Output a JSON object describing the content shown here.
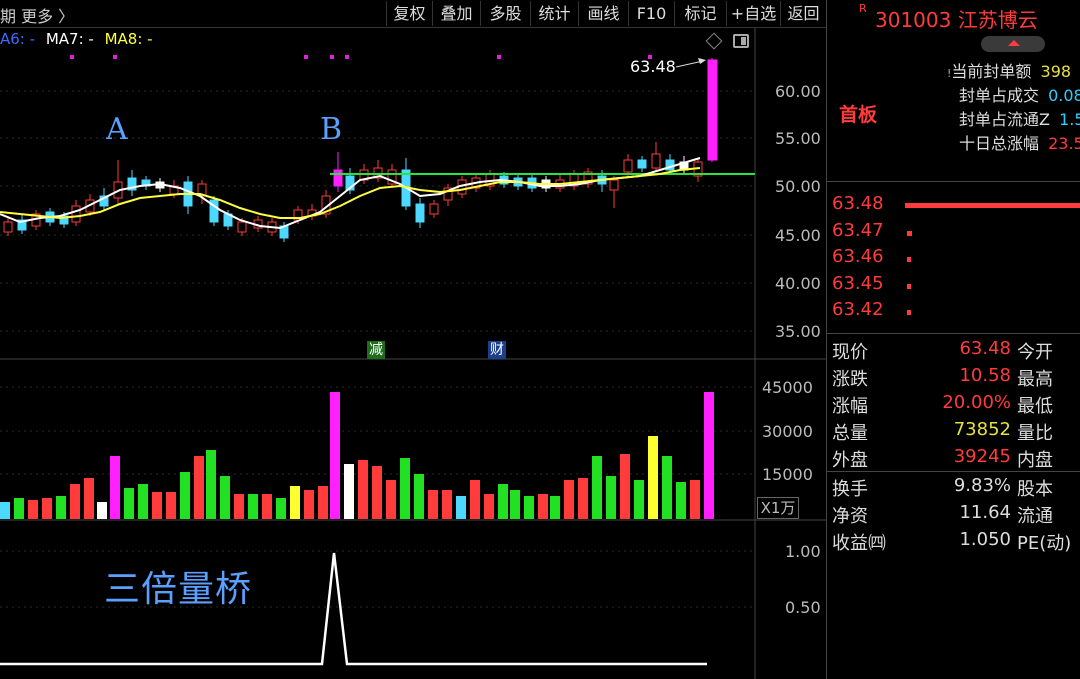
{
  "topbar": {
    "left_text": "期  更多 〉",
    "buttons": [
      "复权",
      "叠加",
      "多股",
      "统计",
      "画线",
      "F10",
      "标记",
      "+自选",
      "返回"
    ]
  },
  "ma_legend": {
    "ma6": "A6: -",
    "ma7": "MA7: -",
    "ma8": "MA8: -",
    "colors": {
      "ma6": "#3b6cff",
      "ma7": "#ffffff",
      "ma8": "#ffff40"
    }
  },
  "main_chart": {
    "price_axis": [
      "60.00",
      "55.00",
      "50.00",
      "45.00",
      "40.00",
      "35.00"
    ],
    "last_price_label": "63.48",
    "marker_a": "A",
    "marker_b": "B",
    "event_tags": {
      "jian": "减",
      "cai": "财"
    }
  },
  "volume_chart": {
    "axis": [
      "45000",
      "30000",
      "15000"
    ],
    "unit_label": "X1万"
  },
  "indicator": {
    "title": "三倍量桥",
    "axis": [
      "1.00",
      "0.50"
    ]
  },
  "right_panel": {
    "code_badge": "R",
    "title": "301003 江苏博云",
    "board_label": "首板",
    "seal_rows": [
      {
        "label": "当前封单额",
        "value": "398",
        "color": "#e8e040"
      },
      {
        "label": "封单占成交",
        "value": "0.08",
        "color": "#2bd0ff"
      },
      {
        "label": "封单占流通Z",
        "value": "1.5",
        "color": "#2bd0ff"
      },
      {
        "label": "十日总涨幅",
        "value": "23.5",
        "color": "#ff3b3b"
      }
    ],
    "order_book": [
      "63.48",
      "63.47",
      "63.46",
      "63.45",
      "63.42"
    ],
    "quote": [
      {
        "label": "现价",
        "value": "63.48",
        "color": "#ff3b3b",
        "label2": "今开"
      },
      {
        "label": "涨跌",
        "value": "10.58",
        "color": "#ff3b3b",
        "label2": "最高"
      },
      {
        "label": "涨幅",
        "value": "20.00%",
        "color": "#ff3b3b",
        "label2": "最低"
      },
      {
        "label": "总量",
        "value": "73852",
        "color": "#e8e040",
        "label2": "量比"
      },
      {
        "label": "外盘",
        "value": "39245",
        "color": "#ff3b3b",
        "label2": "内盘"
      },
      {
        "label": "换手",
        "value": "9.83%",
        "color": "#dddddd",
        "label2": "股本"
      },
      {
        "label": "净资",
        "value": "11.64",
        "color": "#dddddd",
        "label2": "流通"
      },
      {
        "label": "收益㈣",
        "value": "1.050",
        "color": "#dddddd",
        "label2": "PE(动)"
      }
    ]
  }
}
